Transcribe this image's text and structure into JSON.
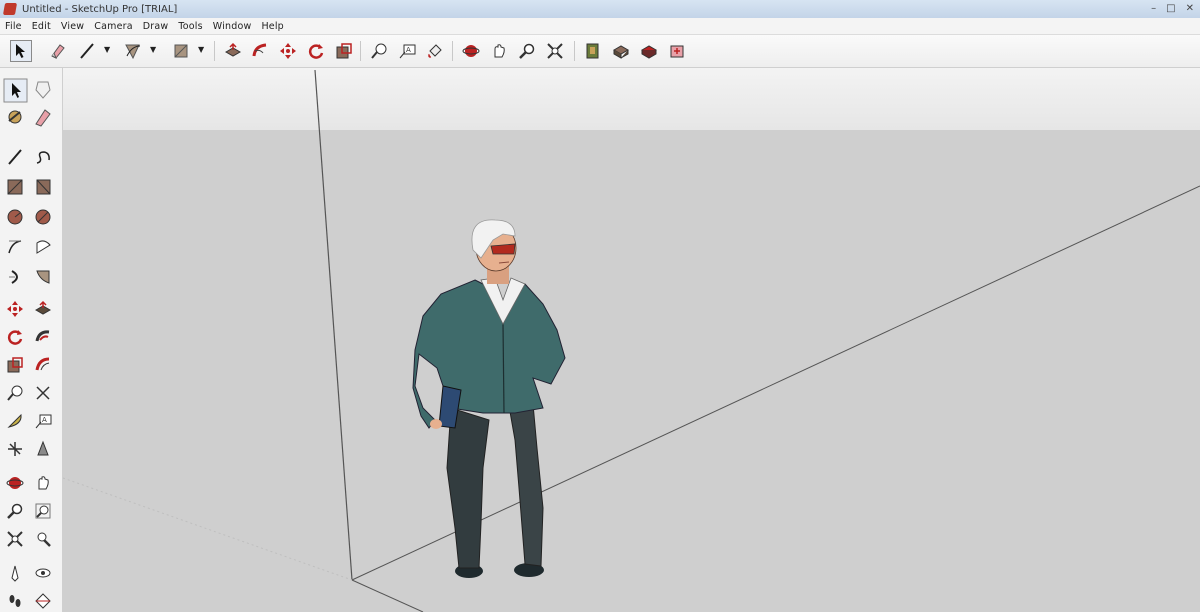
{
  "window": {
    "title": "Untitled - SketchUp Pro [TRIAL]",
    "controls": [
      "–",
      "□",
      "✕"
    ]
  },
  "menu": [
    "File",
    "Edit",
    "View",
    "Camera",
    "Draw",
    "Tools",
    "Window",
    "Help"
  ],
  "toolbar": {
    "tools": [
      "select",
      "eraser",
      "line",
      "line-dropdown",
      "arc",
      "arc-dropdown",
      "rectangle",
      "rectangle-dropdown",
      "push-pull",
      "follow-me",
      "move",
      "rotate",
      "scale",
      "tape-measure",
      "text",
      "paint-bucket",
      "orbit",
      "pan",
      "zoom",
      "zoom-extents",
      "warehouse",
      "components",
      "share-model",
      "extension"
    ]
  },
  "left_toolbar": {
    "tools": [
      "select",
      "make-component",
      "paint-bucket",
      "eraser",
      "line",
      "freehand",
      "rectangle",
      "rotated-rectangle",
      "circle",
      "polygon",
      "arc",
      "pie",
      "two-point-arc",
      "three-point-arc",
      "move",
      "push-pull",
      "rotate",
      "follow-me",
      "scale",
      "offset",
      "tape-measure",
      "dimension",
      "protractor",
      "text",
      "axes",
      "3d-text",
      "orbit",
      "pan",
      "zoom",
      "zoom-window",
      "zoom-extents",
      "previous",
      "position-camera",
      "look-around",
      "walk",
      "section-plane"
    ]
  },
  "viewport": {
    "model": "scale-figure",
    "colors": {
      "sky": "#eeeeee",
      "ground": "#cfcfcf",
      "jacket": "#3f6b6b",
      "pants": "#3a4447",
      "hair": "#f2f2f2",
      "skin": "#e7b08f",
      "glasses": "#b22a1e"
    }
  }
}
